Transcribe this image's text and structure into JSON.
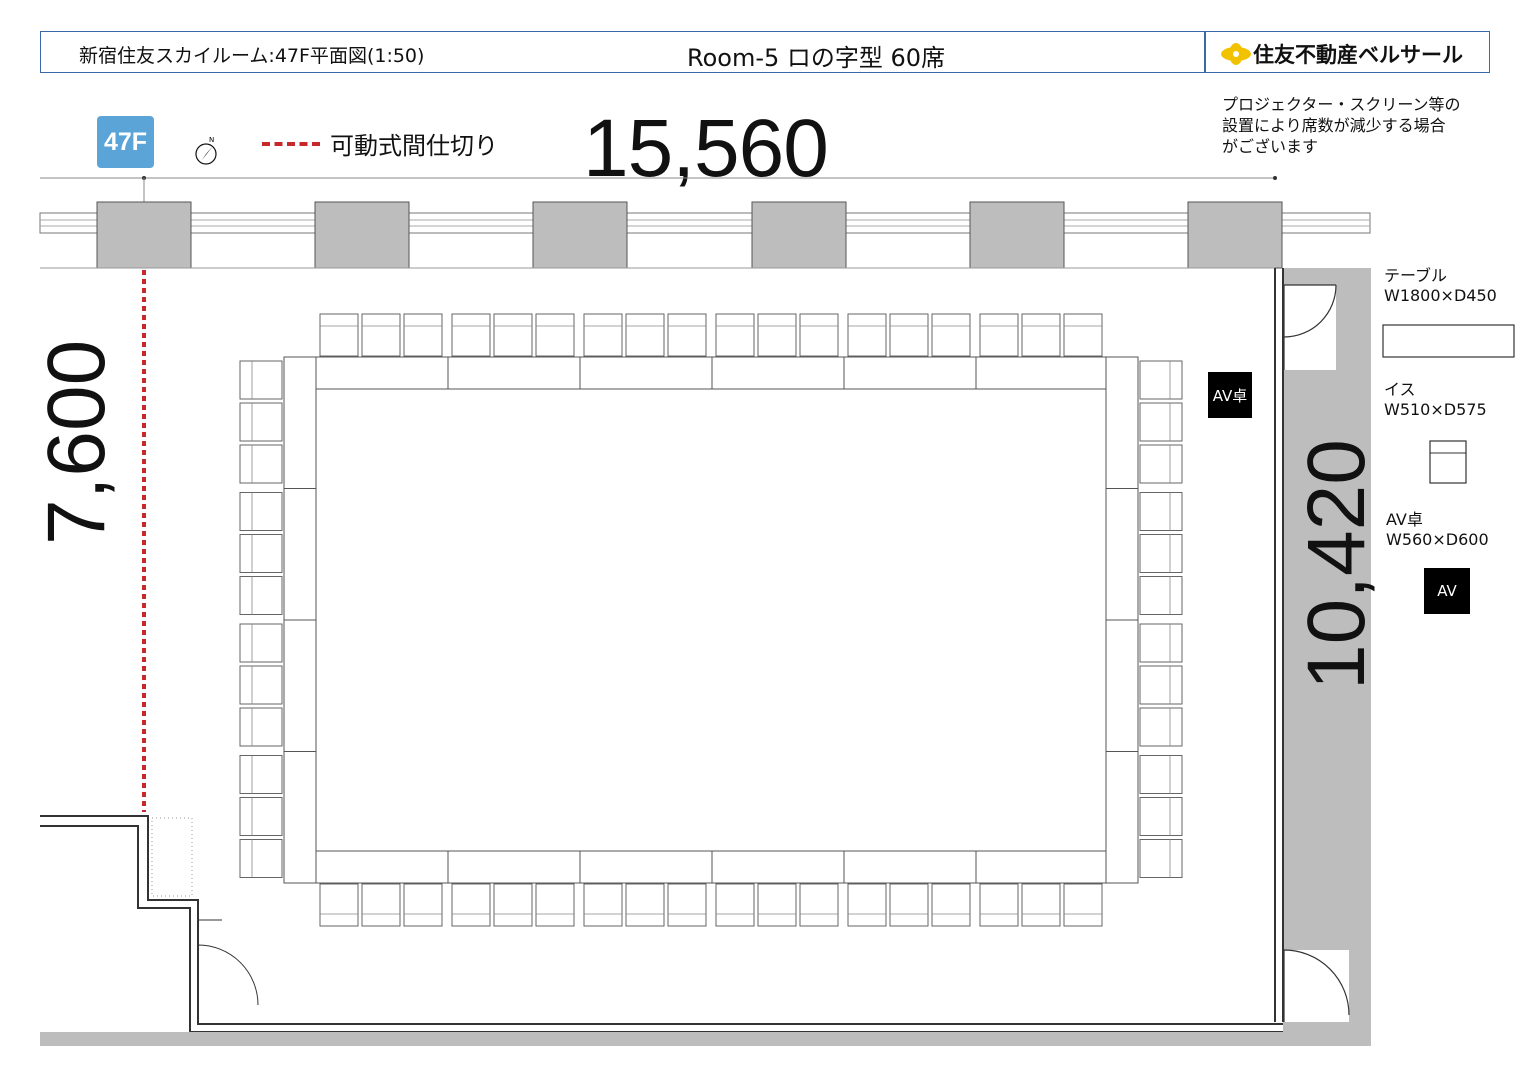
{
  "header": {
    "venue": "新宿住友スカイルーム:47F平面図(1:50)",
    "room": "Room-5 ロの字型 60席",
    "brand": "住友不動産ベルサール",
    "brand_color": "#f2c200"
  },
  "floor_badge": "47F",
  "compass_label": "N",
  "partition_legend": {
    "label": "可動式間仕切り",
    "color": "#c8282c"
  },
  "dimensions": {
    "width": "15,560",
    "height": "7,600",
    "depth": "10,420"
  },
  "note": "プロジェクター・スクリーン等の\n設置により席数が減少する場合\nがございます",
  "legend": {
    "table": {
      "name": "テーブル",
      "size": "W1800×D450"
    },
    "chair": {
      "name": "イス",
      "size": "W510×D575"
    },
    "av": {
      "name": "AV卓",
      "size": "W560×D600",
      "symbol": "AV"
    }
  },
  "av_desk_label": "AV卓",
  "layout": {
    "style": "ロの字型",
    "seats": 60,
    "top_tables": 6,
    "bottom_tables": 6,
    "left_tables": 4,
    "right_tables": 4
  }
}
